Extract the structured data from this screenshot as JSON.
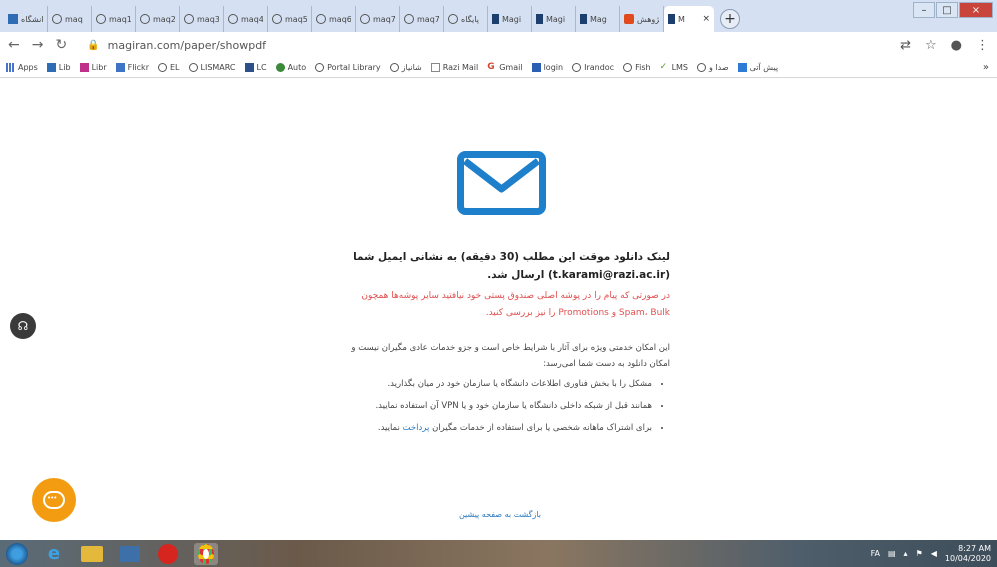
{
  "browser": {
    "tabs": [
      {
        "label": "دانشگاه",
        "icon": "uni-icon",
        "active": false
      },
      {
        "label": "maq",
        "icon": "globe-icon",
        "active": false
      },
      {
        "label": "maq1",
        "icon": "globe-icon",
        "active": false
      },
      {
        "label": "maq2",
        "icon": "globe-icon",
        "active": false
      },
      {
        "label": "maq3",
        "icon": "globe-icon",
        "active": false
      },
      {
        "label": "maq4",
        "icon": "globe-icon",
        "active": false
      },
      {
        "label": "maq5",
        "icon": "globe-icon",
        "active": false
      },
      {
        "label": "maq6",
        "icon": "globe-icon",
        "active": false
      },
      {
        "label": "maq7",
        "icon": "globe-icon",
        "active": false
      },
      {
        "label": "maq7",
        "icon": "globe-icon",
        "active": false
      },
      {
        "label": "پایگاه",
        "icon": "globe-icon",
        "active": false
      },
      {
        "label": "Magi",
        "icon": "magiran-icon",
        "active": false
      },
      {
        "label": "Magi",
        "icon": "magiran-icon",
        "active": false
      },
      {
        "label": "Mag",
        "icon": "magiran-icon",
        "active": false
      },
      {
        "label": "پژوهش",
        "icon": "google-scholar-icon",
        "active": false
      },
      {
        "label": "M",
        "icon": "magiran-icon",
        "active": true
      }
    ],
    "active_tab_close": "×",
    "new_tab": "+",
    "window_controls": {
      "minimize": "–",
      "maximize": "□",
      "close": "×"
    },
    "url": "magiran.com/paper/showpdf",
    "bookmarks": [
      {
        "label": "Apps",
        "icon": "apps-grid-icon"
      },
      {
        "label": "Lib",
        "icon": "library-icon"
      },
      {
        "label": "Libr",
        "icon": "libr-icon"
      },
      {
        "label": "Flickr",
        "icon": "flickr-icon"
      },
      {
        "label": "EL",
        "icon": "globe-icon"
      },
      {
        "label": "LISMARC",
        "icon": "globe-icon"
      },
      {
        "label": "LC",
        "icon": "lc-icon"
      },
      {
        "label": "Auto",
        "icon": "auto-icon"
      },
      {
        "label": "Portal Library",
        "icon": "globe-icon"
      },
      {
        "label": "شانیاز",
        "icon": "globe-icon"
      },
      {
        "label": "Razi Mail",
        "icon": "mail-icon"
      },
      {
        "label": "Gmail",
        "icon": "gmail-icon"
      },
      {
        "label": "login",
        "icon": "login-icon"
      },
      {
        "label": "Irandoc",
        "icon": "globe-icon"
      },
      {
        "label": "Fish",
        "icon": "globe-icon"
      },
      {
        "label": "LMS",
        "icon": "lms-icon"
      },
      {
        "label": "صدا و",
        "icon": "globe-icon"
      },
      {
        "label": "پیش آتی",
        "icon": "bookmark-icon"
      }
    ],
    "bookmarks_more": "»"
  },
  "page": {
    "main_message": "لینک دانلود موقت این مطلب (30 دقیقه) به نشانی ایمیل شما (t.karami@razi.ac.ir) ارسال شد.",
    "warning_message": "در صورتی که پیام را در پوشه اصلی صندوق پستی خود نیافتید سایر پوشه‌ها همچون Spam، Bulk و Promotions را نیز بررسی کنید.",
    "info_intro": "این امکان خدمتی ویژه برای آثار با شرایط خاص است و جزو خدمات عادی مگیران نیست و امکان دانلود به دست شما امی‌رسد:",
    "info_items": [
      "مشکل را با بخش فناوری اطلاعات دانشگاه یا سازمان خود در میان بگذارید.",
      "همانند قبل از شبکه داخلی دانشگاه یا سازمان خود و یا VPN آن استفاده نمایید."
    ],
    "info_item3_text": "برای اشتراک ماهانه شخصی یا برای استفاده از خدمات مگیران",
    "info_item3_link": "پرداخت",
    "info_item3_suffix": "نمایید.",
    "back_link": "بازگشت به صفحه پیشین"
  },
  "taskbar": {
    "apps": [
      "start-orb-icon",
      "internet-explorer-icon",
      "file-explorer-icon",
      "media-player-icon",
      "opera-icon",
      "chrome-icon"
    ],
    "lang": "FA",
    "clock_time": "8:27 AM",
    "clock_date": "10/04/2020"
  },
  "colors": {
    "envelope": "#1e7fcb",
    "warning": "#e05050",
    "link": "#2a7ac0",
    "chat_button": "#f39c12"
  }
}
